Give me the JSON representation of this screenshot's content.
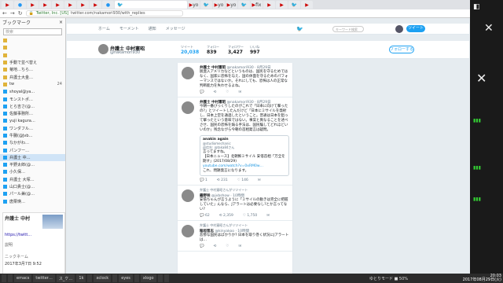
{
  "browser": {
    "tabs": [
      {
        "icon": "youtube-favicon",
        "label": "",
        "active": false
      },
      {
        "icon": "blue-dot-favicon",
        "label": "",
        "active": false
      },
      {
        "icon": "youtube-favicon",
        "label": "",
        "active": false
      },
      {
        "icon": "youtube-favicon",
        "label": "",
        "active": false
      },
      {
        "icon": "youtube-favicon",
        "label": "",
        "active": false
      },
      {
        "icon": "youtube-favicon",
        "label": "",
        "active": false
      },
      {
        "icon": "youtube-favicon",
        "label": "",
        "active": false
      },
      {
        "icon": "youtube-favicon",
        "label": "",
        "active": false
      },
      {
        "icon": "blue-dot-favicon",
        "label": "",
        "active": false
      },
      {
        "icon": "twitter-favicon",
        "label": "",
        "active": true
      },
      {
        "icon": "youtube-favicon",
        "label": "yo",
        "active": false
      },
      {
        "icon": "twitter-favicon",
        "label": "",
        "active": false
      },
      {
        "icon": "youtube-favicon",
        "label": "yo",
        "active": false
      },
      {
        "icon": "youtube-favicon",
        "label": "yo",
        "active": false
      },
      {
        "icon": "twitter-favicon",
        "label": "",
        "active": false
      },
      {
        "icon": "youtube-favicon",
        "label": "fix",
        "active": false
      },
      {
        "icon": "youtube-favicon",
        "label": "",
        "active": false
      },
      {
        "icon": "youtube-favicon",
        "label": "",
        "active": false
      },
      {
        "icon": "twitter-favicon",
        "label": "",
        "active": false
      },
      {
        "icon": "youtube-favicon",
        "label": "",
        "active": false
      }
    ],
    "address": {
      "site_label": "Twitter, Inc. [US]",
      "url": "twitter.com/nakamori930/with_replies"
    }
  },
  "sidebar": {
    "title": "ブックマーク",
    "close_glyph": "×",
    "search_placeholder": "検索",
    "items": [
      {
        "label": "",
        "count": ""
      },
      {
        "label": "",
        "count": ""
      },
      {
        "label": "",
        "count": ""
      },
      {
        "label": "手動で並べ替え",
        "count": ""
      },
      {
        "label": "菊地…ちら…",
        "count": ""
      },
      {
        "label": "弁護士大金…",
        "count": ""
      },
      {
        "label": "tw",
        "count": "24"
      },
      {
        "label": "shoyal@ya…",
        "count": ""
      },
      {
        "label": "モンストポ…",
        "count": ""
      },
      {
        "label": "とら吉さ(@…",
        "count": ""
      },
      {
        "label": "佐藤事務所…",
        "count": ""
      },
      {
        "label": "yuji kagura…",
        "count": ""
      },
      {
        "label": "ワンダフル…",
        "count": ""
      },
      {
        "label": "牛腸(@Jvb…",
        "count": ""
      },
      {
        "label": "なかがわ…",
        "count": ""
      },
      {
        "label": "パンフー…",
        "count": ""
      },
      {
        "label": "弁護士 中…",
        "count": ""
      },
      {
        "label": "平野太郎(@…",
        "count": ""
      },
      {
        "label": "小久保…",
        "count": ""
      },
      {
        "label": "弁護士 大塚…",
        "count": ""
      },
      {
        "label": "山口貴士(@…",
        "count": ""
      },
      {
        "label": "パール兼(@…",
        "count": ""
      },
      {
        "label": "唐栗瑛…",
        "count": ""
      }
    ],
    "preview": {
      "title": "弁護士 中村",
      "url": "https://twitt…",
      "desc": "説明",
      "added_label": "ニックネーム",
      "date": "2017年3月7日 9:52"
    }
  },
  "twitter": {
    "header": {
      "home": "ホーム",
      "moments": "モーメント",
      "notifications": "通知",
      "messages": "メッセージ",
      "search_placeholder": "キーワード検索",
      "tweet_button": "ツイート"
    },
    "profile": {
      "name": "弁護士 中村憲昭",
      "handle": "@nakamori930",
      "stats": [
        {
          "label": "ツイート",
          "value": "20,038",
          "active": true
        },
        {
          "label": "フォロー",
          "value": "839",
          "active": false
        },
        {
          "label": "フォロワー",
          "value": "3,427",
          "active": false
        },
        {
          "label": "いいね",
          "value": "997",
          "active": false
        }
      ],
      "follow_button": "フォローする"
    },
    "tweets": [
      {
        "rt_label": "",
        "name": "弁護士 中村憲昭",
        "handle": "@nakamori930 · 8月29日",
        "text": "脱亜入アメリカなどというものは、国民を守るためではなく、国家に恐怖を与え、国の体面を守るためのパフォーマンスではないか。それにしても、恐怖は人の正常な判断能力を失わせるよね。",
        "replies": "",
        "retweets": "",
        "likes": ""
      },
      {
        "rt_label": "",
        "name": "弁護士 中村憲昭",
        "handle": "@nakamori930 · 8月29日",
        "text": "今朝一番びっくりしたのがこれで「日本に向けて撃ったの?」とツイートしたんだけど「日本にミサイルを発射し、日本上空を通過したということ。普通は日本を狙って撃ったという意味ではない。事案と異なることを述べさせ、国民の恐怖を煽る手法は、国民騙してどれほどいいのか」残念ながら今朝の首相発言は疑問。",
        "quote": {
          "name": "anakin again",
          "handle": "@studiomechanic",
          "reply_to": "返信先: @taka84さん",
          "lines": [
            "言ってますね。",
            "【日本ニュース】北朝鮮ミサイル 安倍首相「万全を期す」(2017/08/29)",
            "youtube.com/watch?v=0xRM0w…",
            "これ、問題発言になります。"
          ]
        },
        "replies": "1",
        "retweets": "231",
        "likes": "146"
      },
      {
        "rt_label": "弁護士 中村憲昭さんがリツイート",
        "name": "霧野咲",
        "handle": "@jvbshow · 10時間",
        "text": "安倍ちゃんが言うように「ミサイルの動きは完全に把握していた」んなら、Jアラートは必要なし?とか言ってない?",
        "replies": "62",
        "retweets": "2,359",
        "likes": "1,750"
      },
      {
        "rt_label": "弁護士 中村憲昭さんがリツイート",
        "name": "稲垣晋志",
        "handle": "@kinyakoo · 10時間",
        "text": "悲惨な国民はばかりか?  日本を取り巻く状況にJアラートは…",
        "replies": "",
        "retweets": "",
        "likes": ""
      }
    ]
  },
  "taskbar": {
    "items": [
      "",
      "",
      "emacs",
      "twitter…",
      "ス_ケ…",
      "1k",
      "",
      "xclock",
      "",
      "eyes",
      "",
      "xlogo",
      "",
      ""
    ],
    "status": "ゆとりモード  ■ 50%",
    "time": "20:03",
    "date": "2017年08月29日(火)"
  }
}
